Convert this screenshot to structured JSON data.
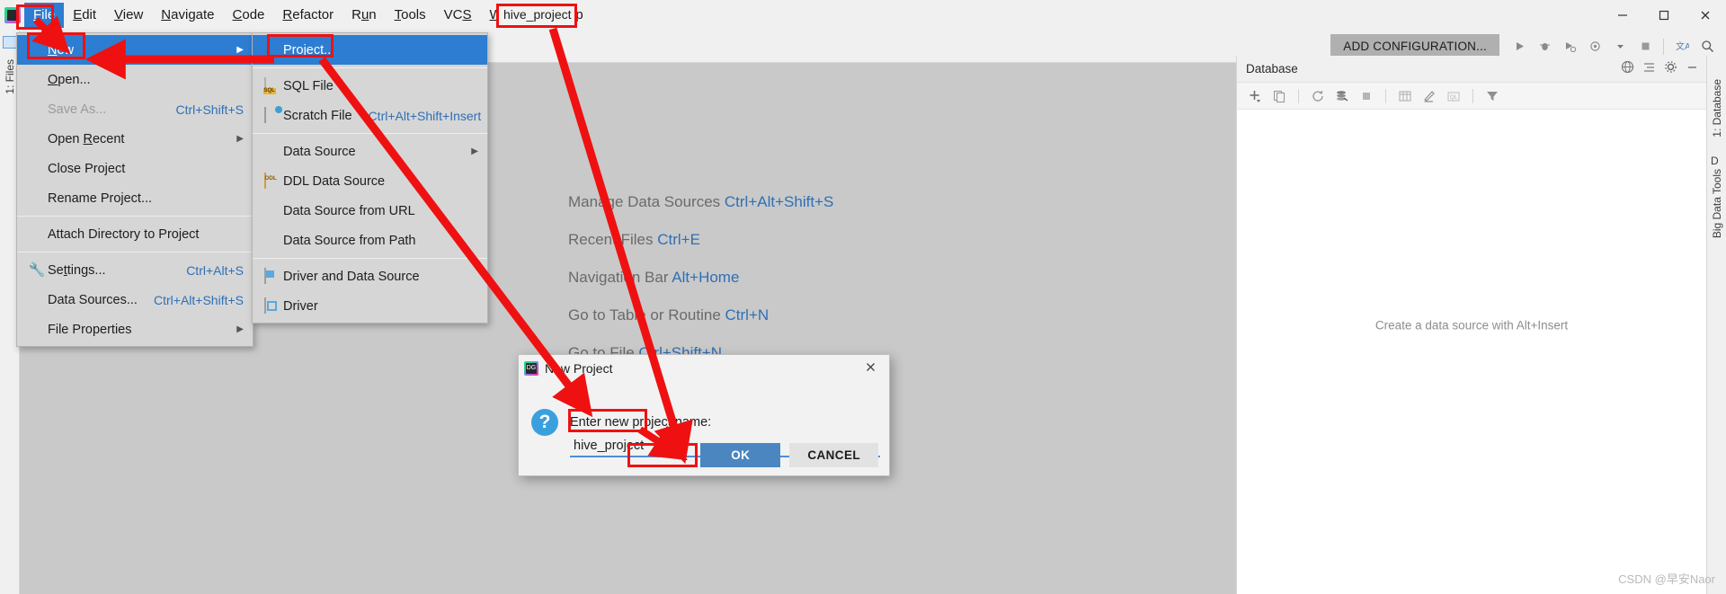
{
  "window": {
    "app_icon": "datagrip-icon",
    "controls": {
      "minimize": "minimize-icon",
      "maximize": "maximize-icon",
      "close": "close-icon"
    }
  },
  "menubar": {
    "items": [
      {
        "label": "File",
        "mnemonic": "F",
        "active": true
      },
      {
        "label": "Edit",
        "mnemonic": "E",
        "active": false
      },
      {
        "label": "View",
        "mnemonic": "V",
        "active": false
      },
      {
        "label": "Navigate",
        "mnemonic": "N",
        "active": false
      },
      {
        "label": "Code",
        "mnemonic": "C",
        "active": false
      },
      {
        "label": "Refactor",
        "mnemonic": "R",
        "active": false
      },
      {
        "label": "Run",
        "mnemonic": "u",
        "active": false
      },
      {
        "label": "Tools",
        "mnemonic": "T",
        "active": false
      },
      {
        "label": "VCS",
        "mnemonic": "S",
        "active": false
      },
      {
        "label": "Window",
        "mnemonic": "W",
        "active": false
      },
      {
        "label": "Help",
        "mnemonic": "H",
        "active": false
      }
    ]
  },
  "toolbar": {
    "add_configuration": "ADD CONFIGURATION...",
    "icons": [
      "run-icon",
      "debug-icon",
      "run-with-coverage-icon",
      "profile-icon",
      "chevron-down-icon",
      "stop-icon",
      "translate-icon",
      "search-everywhere-icon"
    ]
  },
  "file_menu": {
    "items": [
      {
        "label": "New",
        "mnemonic": "N",
        "icon": "",
        "shortcut": "",
        "submenu": true,
        "selected": true,
        "disabled": false
      },
      {
        "label": "Open...",
        "mnemonic": "O",
        "icon": "folder-icon",
        "shortcut": "",
        "submenu": false,
        "selected": false,
        "disabled": false
      },
      {
        "label": "Save As...",
        "mnemonic": "",
        "icon": "",
        "shortcut": "Ctrl+Shift+S",
        "submenu": false,
        "selected": false,
        "disabled": true
      },
      {
        "label": "Open Recent",
        "mnemonic": "R",
        "icon": "",
        "shortcut": "",
        "submenu": true,
        "selected": false,
        "disabled": false
      },
      {
        "label": "Close Project",
        "mnemonic": "",
        "icon": "",
        "shortcut": "",
        "submenu": false,
        "selected": false,
        "disabled": false
      },
      {
        "label": "Rename Project...",
        "mnemonic": "",
        "icon": "",
        "shortcut": "",
        "submenu": false,
        "selected": false,
        "disabled": false
      },
      {
        "separator": true
      },
      {
        "label": "Attach Directory to Project",
        "mnemonic": "",
        "icon": "",
        "shortcut": "",
        "submenu": false,
        "selected": false,
        "disabled": false
      },
      {
        "separator": true
      },
      {
        "label": "Settings...",
        "mnemonic": "t",
        "icon": "wrench-icon",
        "shortcut": "Ctrl+Alt+S",
        "submenu": false,
        "selected": false,
        "disabled": false
      },
      {
        "label": "Data Sources...",
        "mnemonic": "",
        "icon": "database-icon",
        "shortcut": "Ctrl+Alt+Shift+S",
        "submenu": false,
        "selected": false,
        "disabled": false
      },
      {
        "label": "File Properties",
        "mnemonic": "",
        "icon": "",
        "shortcut": "",
        "submenu": true,
        "selected": false,
        "disabled": false
      }
    ]
  },
  "new_submenu": {
    "items": [
      {
        "label": "Project...",
        "icon": "",
        "shortcut": "",
        "submenu": false,
        "selected": true
      },
      {
        "separator": true
      },
      {
        "label": "SQL File",
        "icon": "sql-file-icon",
        "shortcut": "",
        "submenu": false,
        "selected": false
      },
      {
        "label": "Scratch File",
        "icon": "scratch-file-icon",
        "shortcut": "Ctrl+Alt+Shift+Insert",
        "submenu": false,
        "selected": false
      },
      {
        "separator": true
      },
      {
        "label": "Data Source",
        "icon": "database-icon",
        "shortcut": "",
        "submenu": true,
        "selected": false
      },
      {
        "label": "DDL Data Source",
        "icon": "ddl-icon",
        "shortcut": "",
        "submenu": false,
        "selected": false
      },
      {
        "label": "Data Source from URL",
        "icon": "url-icon",
        "shortcut": "",
        "submenu": false,
        "selected": false
      },
      {
        "label": "Data Source from Path",
        "icon": "folder-icon",
        "shortcut": "",
        "submenu": false,
        "selected": false
      },
      {
        "separator": true
      },
      {
        "label": "Driver and Data Source",
        "icon": "driver-data-source-icon",
        "shortcut": "",
        "submenu": false,
        "selected": false
      },
      {
        "label": "Driver",
        "icon": "driver-icon",
        "shortcut": "",
        "submenu": false,
        "selected": false
      }
    ]
  },
  "workspace_hints": [
    {
      "text": "Manage Data Sources ",
      "key": "Ctrl+Alt+Shift+S"
    },
    {
      "text": "Recent Files ",
      "key": "Ctrl+E"
    },
    {
      "text": "Navigation Bar ",
      "key": "Alt+Home"
    },
    {
      "text": "Go to Table or Routine ",
      "key": "Ctrl+N"
    },
    {
      "text": "Go to File ",
      "key": "Ctrl+Shift+N"
    }
  ],
  "database_panel": {
    "title": "Database",
    "empty_message": "Create a data source with Alt+Insert",
    "header_icons": [
      "globe-icon",
      "collapse-all-icon",
      "settings-gear-icon",
      "minimize-panel-icon"
    ],
    "toolbar_icons": [
      "add-icon",
      "copy-icon",
      "refresh-icon",
      "sync-icon",
      "stop-icon",
      "table-icon",
      "edit-icon",
      "query-console-icon",
      "filter-icon"
    ]
  },
  "left_strip": {
    "labels": [
      "1: Files"
    ],
    "icon": "files-icon"
  },
  "right_strip": {
    "labels": [
      "1: Database",
      "D",
      "Big Data Tools"
    ]
  },
  "dialog": {
    "title": "New Project",
    "icon": "datagrip-icon",
    "close_icon": "close-icon",
    "question_icon": "question-icon",
    "label": "Enter new project name:",
    "input_value": "hive_project",
    "input_placeholder": "",
    "ok_label": "OK",
    "cancel_label": "CANCEL"
  },
  "annotation": {
    "project_name_callout": "hive_project",
    "accent_color": "#ef1111"
  },
  "watermark": "CSDN @早安Naor"
}
